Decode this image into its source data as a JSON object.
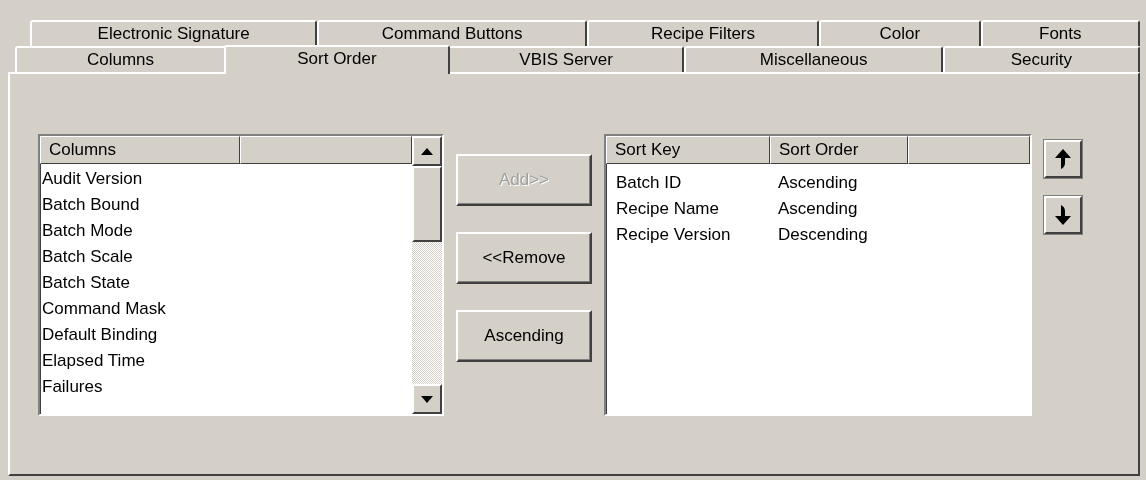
{
  "tab_rows": [
    [
      {
        "label": "Electronic Signature",
        "selected": false
      },
      {
        "label": "Command Buttons",
        "selected": false
      },
      {
        "label": "Recipe Filters",
        "selected": false
      },
      {
        "label": "Color",
        "selected": false
      },
      {
        "label": "Fonts",
        "selected": false
      }
    ],
    [
      {
        "label": "Columns",
        "selected": false
      },
      {
        "label": "Sort Order",
        "selected": true
      },
      {
        "label": "VBIS Server",
        "selected": false
      },
      {
        "label": "Miscellaneous",
        "selected": false
      },
      {
        "label": "Security",
        "selected": false
      }
    ]
  ],
  "available_list": {
    "columns": [
      "Columns"
    ],
    "items": [
      "Audit Version",
      "Batch Bound",
      "Batch Mode",
      "Batch Scale",
      "Batch State",
      "Command Mask",
      "Default Binding",
      "Elapsed Time",
      "Failures"
    ]
  },
  "buttons": [
    {
      "label": "Add>>",
      "disabled": true
    },
    {
      "label": "<<Remove",
      "disabled": false
    },
    {
      "label": "Ascending",
      "disabled": false
    }
  ],
  "sort_list": {
    "columns": [
      "Sort Key",
      "Sort Order"
    ],
    "rows": [
      [
        "Batch ID",
        "Ascending"
      ],
      [
        "Recipe Name",
        "Ascending"
      ],
      [
        "Recipe Version",
        "Descending"
      ]
    ]
  }
}
